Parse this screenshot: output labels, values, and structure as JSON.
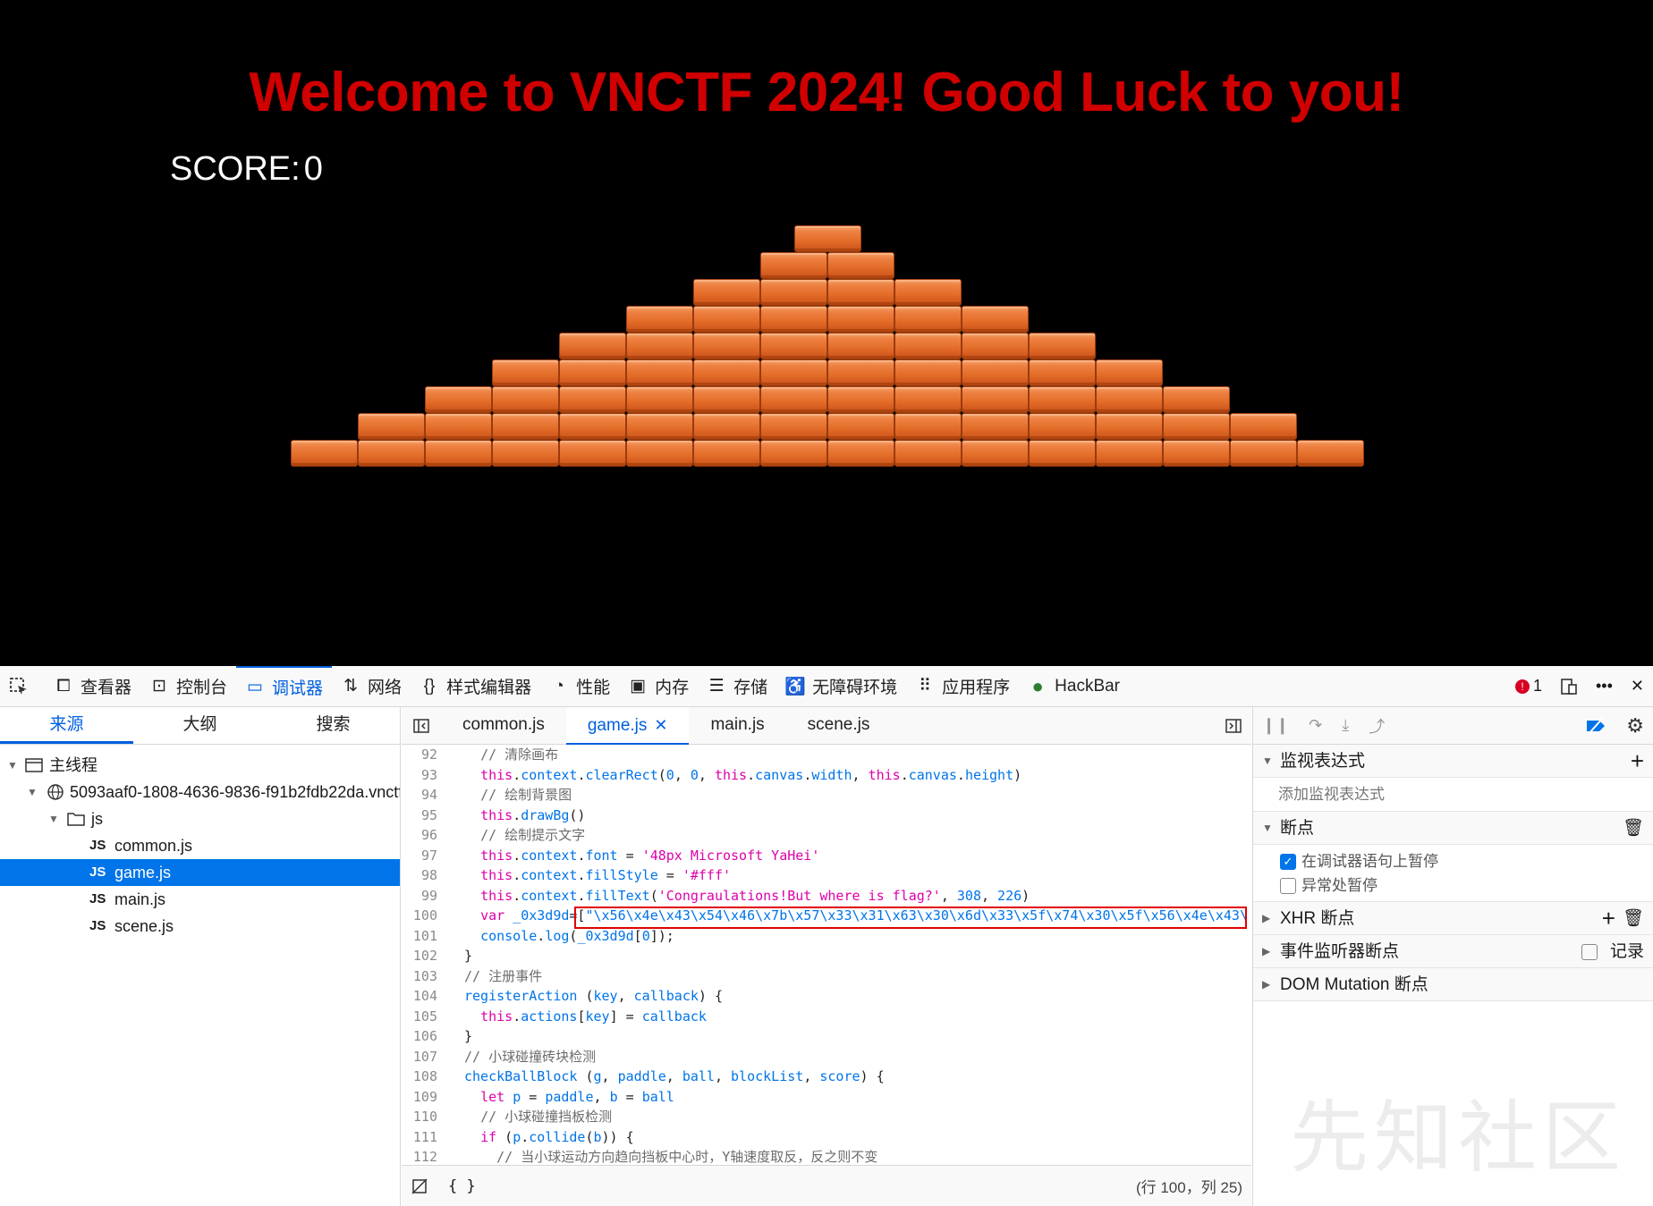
{
  "game": {
    "title": "Welcome to VNCTF 2024! Good Luck to you!",
    "score_label": "SCORE:",
    "score_value": "0",
    "pyramid_rows": [
      1,
      2,
      4,
      6,
      8,
      10,
      12,
      14,
      16
    ]
  },
  "toolbar": {
    "items": [
      {
        "label": "查看器",
        "icon": "inspector-icon"
      },
      {
        "label": "控制台",
        "icon": "console-icon"
      },
      {
        "label": "调试器",
        "icon": "debugger-icon",
        "active": true
      },
      {
        "label": "网络",
        "icon": "network-icon"
      },
      {
        "label": "样式编辑器",
        "icon": "style-editor-icon"
      },
      {
        "label": "性能",
        "icon": "performance-icon"
      },
      {
        "label": "内存",
        "icon": "memory-icon"
      },
      {
        "label": "存储",
        "icon": "storage-icon"
      },
      {
        "label": "无障碍环境",
        "icon": "accessibility-icon"
      },
      {
        "label": "应用程序",
        "icon": "application-icon"
      },
      {
        "label": "HackBar",
        "icon": "hackbar-icon"
      }
    ],
    "error_count": "1"
  },
  "sources": {
    "tabs": [
      "来源",
      "大纲",
      "搜索"
    ],
    "main_thread": "主线程",
    "domain": "5093aaf0-1808-4636-9836-f91b2fdb22da.vnctf",
    "folder": "js",
    "files": [
      "common.js",
      "game.js",
      "main.js",
      "scene.js"
    ],
    "selected_file": "game.js"
  },
  "editor": {
    "tabs": [
      "common.js",
      "game.js",
      "main.js",
      "scene.js"
    ],
    "active_tab": "game.js",
    "lines": [
      {
        "n": "92",
        "indent": "  ",
        "code": "// 清除画布"
      },
      {
        "n": "93",
        "indent": "  ",
        "code": "this.context.clearRect(0, 0, this.canvas.width, this.canvas.height)"
      },
      {
        "n": "94",
        "indent": "  ",
        "code": "// 绘制背景图"
      },
      {
        "n": "95",
        "indent": "  ",
        "code": "this.drawBg()"
      },
      {
        "n": "96",
        "indent": "  ",
        "code": "// 绘制提示文字"
      },
      {
        "n": "97",
        "indent": "  ",
        "code": "this.context.font = '48px Microsoft YaHei'"
      },
      {
        "n": "98",
        "indent": "  ",
        "code": "this.context.fillStyle = '#fff'"
      },
      {
        "n": "99",
        "indent": "  ",
        "code": "this.context.fillText('Congraulations!But where is flag?', 308, 226)"
      },
      {
        "n": "100",
        "indent": "  ",
        "code": "var _0x3d9d=[\"\\x56\\x4e\\x43\\x54\\x46\\x7b\\x57\\x33\\x31\\x63\\x30\\x6d\\x33\\x5f\\x74\\x30\\x5f\\x56\\x4e\\x43\\"
      },
      {
        "n": "101",
        "indent": "  ",
        "code": "console.log(_0x3d9d[0]);"
      },
      {
        "n": "102",
        "indent": "",
        "code": "}"
      },
      {
        "n": "103",
        "indent": "",
        "code": "// 注册事件"
      },
      {
        "n": "104",
        "indent": "",
        "code": "registerAction (key, callback) {"
      },
      {
        "n": "105",
        "indent": "  ",
        "code": "this.actions[key] = callback"
      },
      {
        "n": "106",
        "indent": "",
        "code": "}"
      },
      {
        "n": "107",
        "indent": "",
        "code": "// 小球碰撞砖块检测"
      },
      {
        "n": "108",
        "indent": "",
        "code": "checkBallBlock (g, paddle, ball, blockList, score) {"
      },
      {
        "n": "109",
        "indent": "  ",
        "code": "let p = paddle, b = ball"
      },
      {
        "n": "110",
        "indent": "  ",
        "code": "// 小球碰撞挡板检测"
      },
      {
        "n": "111",
        "indent": "  ",
        "code": "if (p.collide(b)) {"
      },
      {
        "n": "112",
        "indent": "    ",
        "code": "// 当小球运动方向趋向挡板中心时，Y轴速度取反，反之则不变"
      }
    ],
    "footer_braces": "{ }",
    "cursor_position": "(行 100，列 25)"
  },
  "debug_panel": {
    "watch_title": "监视表达式",
    "watch_placeholder": "添加监视表达式",
    "breakpoints_title": "断点",
    "pause_on_debugger": "在调试器语句上暂停",
    "pause_on_exceptions": "异常处暂停",
    "xhr_title": "XHR 断点",
    "event_title": "事件监听器断点",
    "event_log_label": "记录",
    "dom_title": "DOM Mutation 断点"
  },
  "watermark": "先知社区"
}
